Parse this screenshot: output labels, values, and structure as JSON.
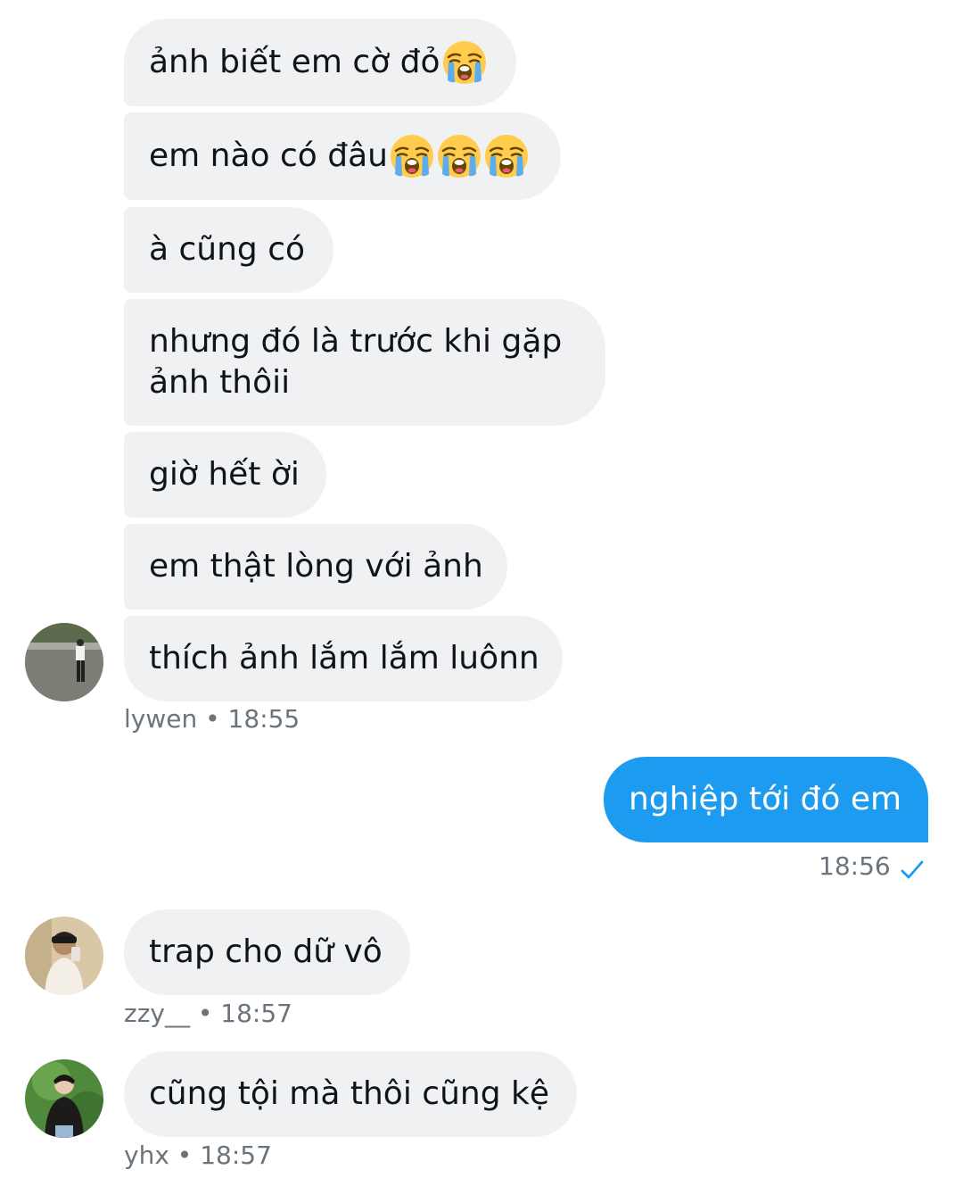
{
  "messages": {
    "m1": {
      "text": "ảnh biết em cờ đỏ",
      "emoji": "loudly-crying-face"
    },
    "m2": {
      "text": "em nào có đâu",
      "emoji": "loudly-crying-face",
      "emoji_count": 3
    },
    "m3": {
      "text": "à cũng có"
    },
    "m4": {
      "line1": "nhưng đó là trước khi gặp",
      "line2": "ảnh thôii"
    },
    "m5": {
      "text": "giờ hết ời"
    },
    "m6": {
      "text": "em thật lòng với ảnh"
    },
    "m7": {
      "text": "thích ảnh lắm lắm luônn"
    },
    "m8": {
      "text": "nghiệp tới đó em"
    },
    "m9": {
      "text": "trap cho dữ vô"
    },
    "m10": {
      "text": "cũng tội mà thôi cũng kệ"
    }
  },
  "meta": {
    "lywen": "lywen • 18:55",
    "me": "18:56",
    "zzy": "zzy__ • 18:57",
    "yhx": "yhx • 18:57"
  },
  "colors": {
    "incoming_bubble": "#f0f1f3",
    "outgoing_bubble": "#1d9bf0",
    "meta_text": "#6b747c",
    "read_check": "#1d9bf0"
  },
  "icons": {
    "read_receipt": "checkmark-icon",
    "emoji": "loudly-crying-face"
  }
}
